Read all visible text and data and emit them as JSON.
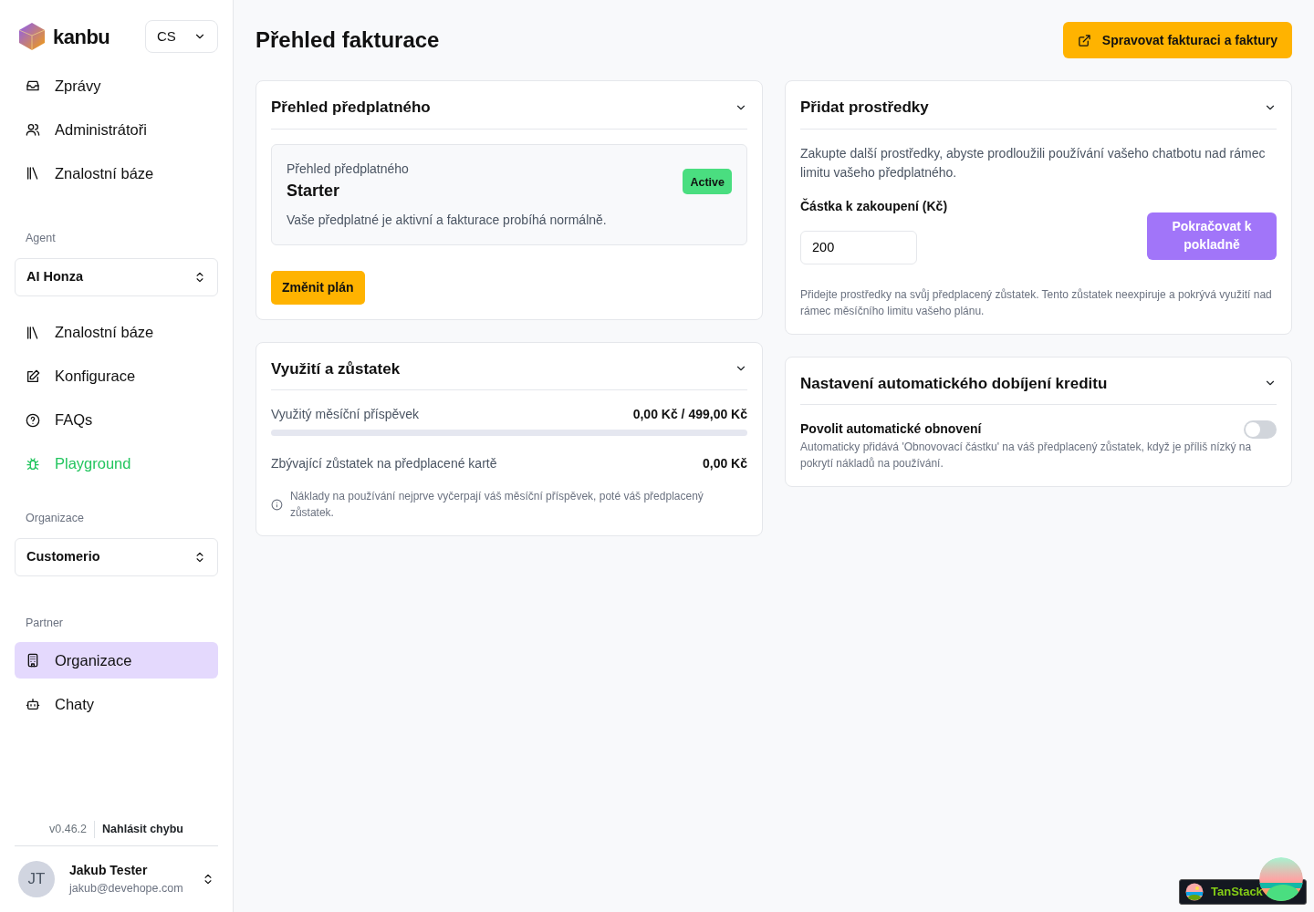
{
  "sidebar": {
    "brand": "kanbu",
    "language": "CS",
    "main_items": [
      {
        "label": "Zprávy",
        "selected": false,
        "accent": false
      },
      {
        "label": "Administrátoři",
        "selected": false,
        "accent": false
      },
      {
        "label": "Znalostní báze",
        "selected": false,
        "accent": false
      }
    ],
    "agent_section": {
      "heading": "Agent",
      "picker": "AI Honza",
      "items": [
        {
          "label": "Znalostní báze",
          "selected": false,
          "accent": false
        },
        {
          "label": "Konfigurace",
          "selected": false,
          "accent": false
        },
        {
          "label": "FAQs",
          "selected": false,
          "accent": false
        },
        {
          "label": "Playground",
          "selected": false,
          "accent": true
        }
      ]
    },
    "org_section": {
      "heading": "Organizace",
      "picker": "Customerio"
    },
    "partner_section": {
      "heading": "Partner",
      "items": [
        {
          "label": "Organizace",
          "selected": true,
          "accent": false
        },
        {
          "label": "Chaty",
          "selected": false,
          "accent": false
        }
      ]
    },
    "version": "v0.46.2",
    "report_link": "Nahlásit chybu",
    "user": {
      "initials": "JT",
      "name": "Jakub Tester",
      "email": "jakub@devehope.com"
    }
  },
  "page": {
    "title": "Přehled fakturace",
    "manage_button": "Spravovat fakturaci a faktury"
  },
  "subscription": {
    "title": "Přehled předplatného",
    "caption": "Přehled předplatného",
    "plan": "Starter",
    "status": "Active",
    "message": "Vaše předplatné je aktivní a fakturace probíhá normálně.",
    "change_button": "Změnit plán"
  },
  "usage": {
    "title": "Využití a zůstatek",
    "allowance_label": "Využitý měsíční příspěvek",
    "allowance_value": "0,00 Kč / 499,00 Kč",
    "level": 0,
    "balance_label": "Zbývající zůstatek na předplacené kartě",
    "balance_value": "0,00 Kč",
    "note": "Náklady na používání nejprve vyčerpají váš měsíční příspěvek, poté váš předplacený zůstatek."
  },
  "funds": {
    "title": "Přidat prostředky",
    "intro": "Zakupte další prostředky, abyste prodloužili používání vašeho chatbotu nad rámec limitu vašeho předplatného.",
    "amount_label": "Částka k zakoupení (Kč)",
    "amount": "200",
    "checkout_button": "Pokračovat k pokladně",
    "note": "Přidejte prostředky na svůj předplacený zůstatek. Tento zůstatek neexpiruje a pokrývá využití nad rámec měsíčního limitu vašeho plánu."
  },
  "auto_recharge": {
    "title": "Nastavení automatického dobíjení kreditu",
    "toggle_label": "Povolit automatické obnovení",
    "on": false,
    "description": "Automaticky přidává 'Obnovovací částku' na váš předplacený zůstatek, když je příliš nízký na pokrytí nákladů na používání."
  },
  "devtools": {
    "label": "TanStack"
  }
}
